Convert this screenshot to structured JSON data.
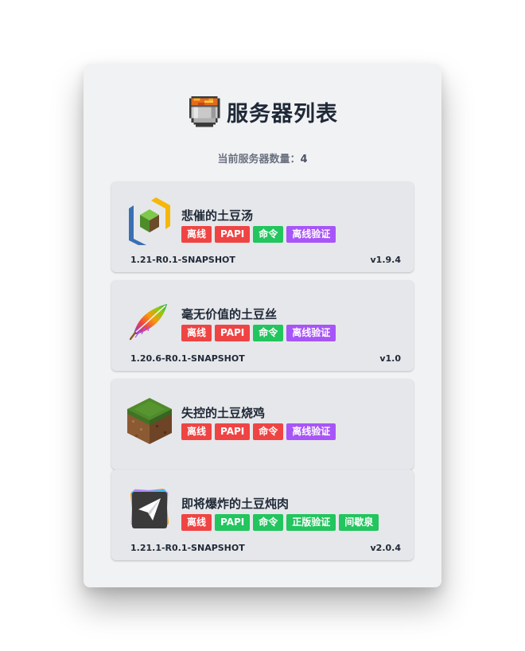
{
  "page": {
    "title": "服务器列表",
    "title_icon": "lava-bucket-icon",
    "count_label": "当前服务器数量：",
    "count_value": "4"
  },
  "colors": {
    "tag_red": "#ef4444",
    "tag_green": "#22c55e",
    "tag_purple": "#a855f7",
    "panel_bg": "#f1f2f4",
    "card_bg": "#e6e7ea"
  },
  "servers": [
    {
      "name": "悲催的土豆汤",
      "icon": "cube-logo-icon",
      "tags": [
        {
          "label": "离线",
          "color": "red"
        },
        {
          "label": "PAPI",
          "color": "red"
        },
        {
          "label": "命令",
          "color": "green"
        },
        {
          "label": "离线验证",
          "color": "purple"
        }
      ],
      "version": "1.21-R0.1-SNAPSHOT",
      "plugin_version": "v1.9.4"
    },
    {
      "name": "毫无价值的土豆丝",
      "icon": "rainbow-feather-icon",
      "tags": [
        {
          "label": "离线",
          "color": "red"
        },
        {
          "label": "PAPI",
          "color": "red"
        },
        {
          "label": "命令",
          "color": "green"
        },
        {
          "label": "离线验证",
          "color": "purple"
        }
      ],
      "version": "1.20.6-R0.1-SNAPSHOT",
      "plugin_version": "v1.0"
    },
    {
      "name": "失控的土豆烧鸡",
      "icon": "grass-block-icon",
      "tags": [
        {
          "label": "离线",
          "color": "red"
        },
        {
          "label": "PAPI",
          "color": "red"
        },
        {
          "label": "命令",
          "color": "red"
        },
        {
          "label": "离线验证",
          "color": "purple"
        }
      ],
      "version": "",
      "plugin_version": ""
    },
    {
      "name": "即将爆炸的土豆炖肉",
      "icon": "paper-plane-icon",
      "tags": [
        {
          "label": "离线",
          "color": "red"
        },
        {
          "label": "PAPI",
          "color": "green"
        },
        {
          "label": "命令",
          "color": "green"
        },
        {
          "label": "正版验证",
          "color": "green"
        },
        {
          "label": "间歇泉",
          "color": "green"
        }
      ],
      "version": "1.21.1-R0.1-SNAPSHOT",
      "plugin_version": "v2.0.4"
    }
  ]
}
